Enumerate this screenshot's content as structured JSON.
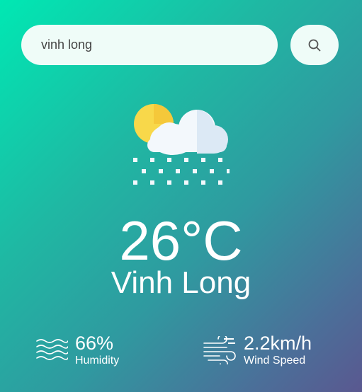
{
  "search": {
    "value": "vinh long",
    "button_icon": "search-icon"
  },
  "weather": {
    "icon": "cloud-sun-snow-icon",
    "temperature": "26°C",
    "city": "Vinh Long"
  },
  "details": {
    "humidity": {
      "icon": "waves-icon",
      "value": "66%",
      "label": "Humidity"
    },
    "wind": {
      "icon": "wind-icon",
      "value": "2.2km/h",
      "label": "Wind Speed"
    }
  },
  "colors": {
    "gradient_start": "#00e8b3",
    "gradient_end": "#5a5890",
    "input_background": "#effcf8"
  }
}
